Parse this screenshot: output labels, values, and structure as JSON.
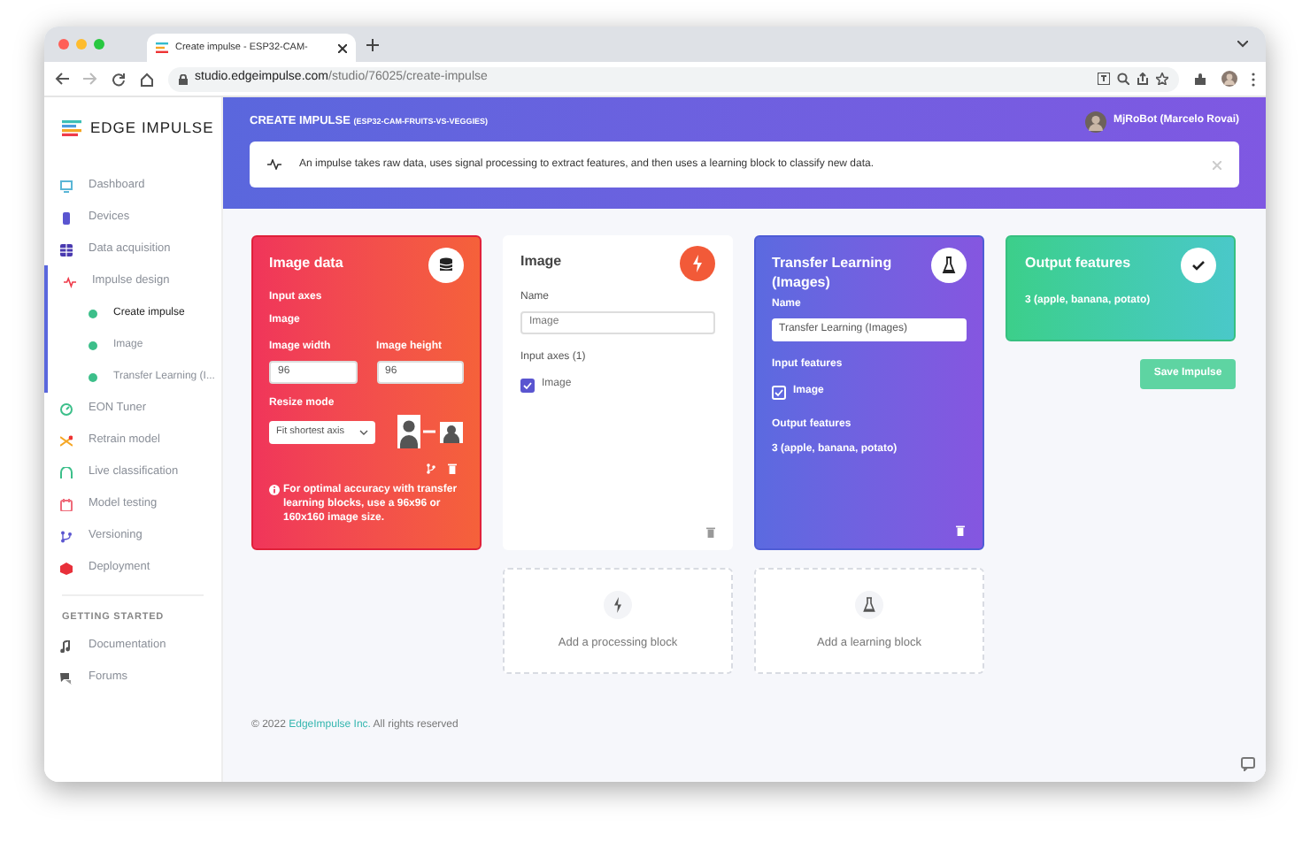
{
  "browser": {
    "tab_title": "Create impulse - ESP32-CAM-",
    "url_host": "studio.edgeimpulse.com",
    "url_path": "/studio/76025/create-impulse"
  },
  "sidebar": {
    "logo": "EDGE IMPULSE",
    "items": [
      {
        "label": "Dashboard",
        "selected": false
      },
      {
        "label": "Devices",
        "selected": false
      },
      {
        "label": "Data acquisition",
        "selected": false
      },
      {
        "label": "Impulse design",
        "selected": false,
        "children": [
          {
            "label": "Create impulse",
            "selected": true
          },
          {
            "label": "Image",
            "selected": false
          },
          {
            "label": "Transfer Learning (I...",
            "selected": false
          }
        ]
      },
      {
        "label": "EON Tuner",
        "selected": false
      },
      {
        "label": "Retrain model",
        "selected": false
      },
      {
        "label": "Live classification",
        "selected": false
      },
      {
        "label": "Model testing",
        "selected": false
      },
      {
        "label": "Versioning",
        "selected": false
      },
      {
        "label": "Deployment",
        "selected": false
      }
    ],
    "section_title": "GETTING STARTED",
    "section_items": [
      "Documentation",
      "Forums"
    ]
  },
  "header": {
    "title": "CREATE IMPULSE",
    "subtitle": "(ESP32-CAM-FRUITS-VS-VEGGIES)",
    "user": "MjRoBot (Marcelo Rovai)",
    "banner": "An impulse takes raw data, uses signal processing to extract features, and then uses a learning block to classify new data."
  },
  "blocks": [
    {
      "kind": "input",
      "title": "Image data",
      "axes_label": "Input axes",
      "axes_value": "Image",
      "width_label": "Image width",
      "width_value": "96",
      "height_label": "Image height",
      "height_value": "96",
      "resize_label": "Resize mode",
      "resize_value": "Fit shortest axis",
      "note": "For optimal accuracy with transfer learning blocks, use a 96x96 or 160x160 image size."
    },
    {
      "kind": "processing",
      "title": "Image",
      "name_label": "Name",
      "name_value": "Image",
      "axes_label": "Input axes (1)",
      "axes": [
        {
          "label": "Image",
          "checked": true
        }
      ]
    },
    {
      "kind": "learning",
      "title": "Transfer Learning (Images)",
      "name_label": "Name",
      "name_value": "Transfer Learning (Images)",
      "inputs_label": "Input features",
      "inputs": [
        {
          "label": "Image",
          "checked": true
        }
      ],
      "outputs_label": "Output features",
      "outputs_value": "3 (apple, banana, potato)"
    },
    {
      "kind": "output",
      "title": "Output features",
      "value": "3 (apple, banana, potato)"
    }
  ],
  "save_button": "Save Impulse",
  "add_blocks": [
    {
      "kind": "processing",
      "label": "Add a processing block"
    },
    {
      "kind": "learning",
      "label": "Add a learning block"
    }
  ],
  "footer": {
    "prefix": "© 2022",
    "link": "EdgeImpulse Inc.",
    "suffix": "All rights reserved"
  }
}
